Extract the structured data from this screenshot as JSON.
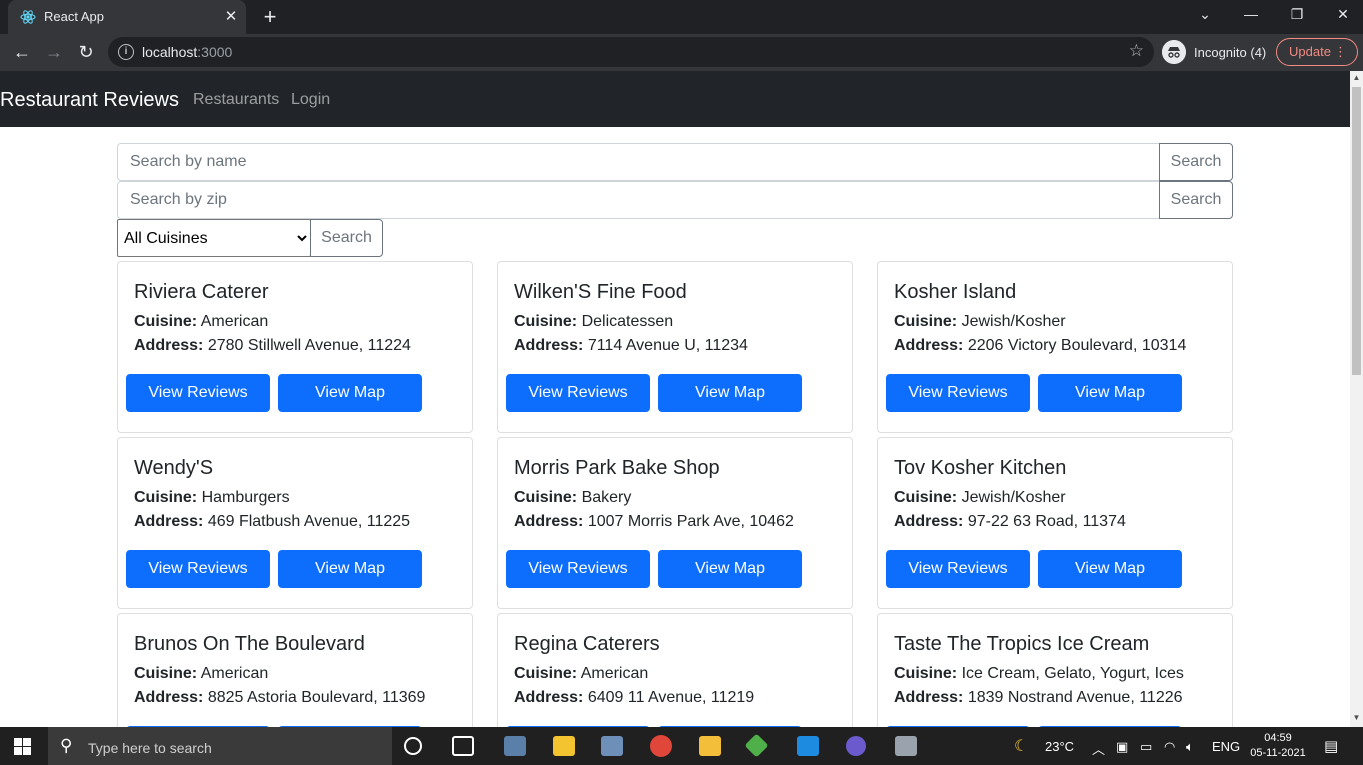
{
  "browser": {
    "tab_title": "React App",
    "url_host": "localhost",
    "url_port": ":3000",
    "profile_label": "Incognito (4)",
    "update_label": "Update"
  },
  "app": {
    "brand": "Restaurant Reviews",
    "nav": {
      "restaurants": "Restaurants",
      "login": "Login"
    },
    "search_name": {
      "placeholder": "Search by name",
      "button": "Search"
    },
    "search_zip": {
      "placeholder": "Search by zip",
      "button": "Search"
    },
    "cuisine": {
      "selected": "All Cuisines",
      "button": "Search"
    },
    "labels": {
      "cuisine": "Cuisine:",
      "address": "Address:",
      "view_reviews": "View Reviews",
      "view_map": "View Map"
    },
    "restaurants": [
      {
        "name": "Riviera Caterer",
        "cuisine": "American",
        "address": "2780 Stillwell Avenue, 11224"
      },
      {
        "name": "Wilken'S Fine Food",
        "cuisine": "Delicatessen",
        "address": "7114 Avenue U, 11234"
      },
      {
        "name": "Kosher Island",
        "cuisine": "Jewish/Kosher",
        "address": "2206 Victory Boulevard, 10314"
      },
      {
        "name": "Wendy'S",
        "cuisine": "Hamburgers",
        "address": "469 Flatbush Avenue, 11225"
      },
      {
        "name": "Morris Park Bake Shop",
        "cuisine": "Bakery",
        "address": "1007 Morris Park Ave, 10462"
      },
      {
        "name": "Tov Kosher Kitchen",
        "cuisine": "Jewish/Kosher",
        "address": "97-22 63 Road, 11374"
      },
      {
        "name": "Brunos On The Boulevard",
        "cuisine": "American",
        "address": "8825 Astoria Boulevard, 11369"
      },
      {
        "name": "Regina Caterers",
        "cuisine": "American",
        "address": "6409 11 Avenue, 11219"
      },
      {
        "name": "Taste The Tropics Ice Cream",
        "cuisine": "Ice Cream, Gelato, Yogurt, Ices",
        "address": "1839 Nostrand Avenue, 11226"
      }
    ]
  },
  "taskbar": {
    "search_placeholder": "Type here to search",
    "weather": "23°C",
    "language": "ENG",
    "time": "04:59",
    "date": "05-11-2021"
  },
  "colors": {
    "primary": "#0d6efd",
    "navbar": "#212529",
    "chrome_dark": "#202124"
  }
}
